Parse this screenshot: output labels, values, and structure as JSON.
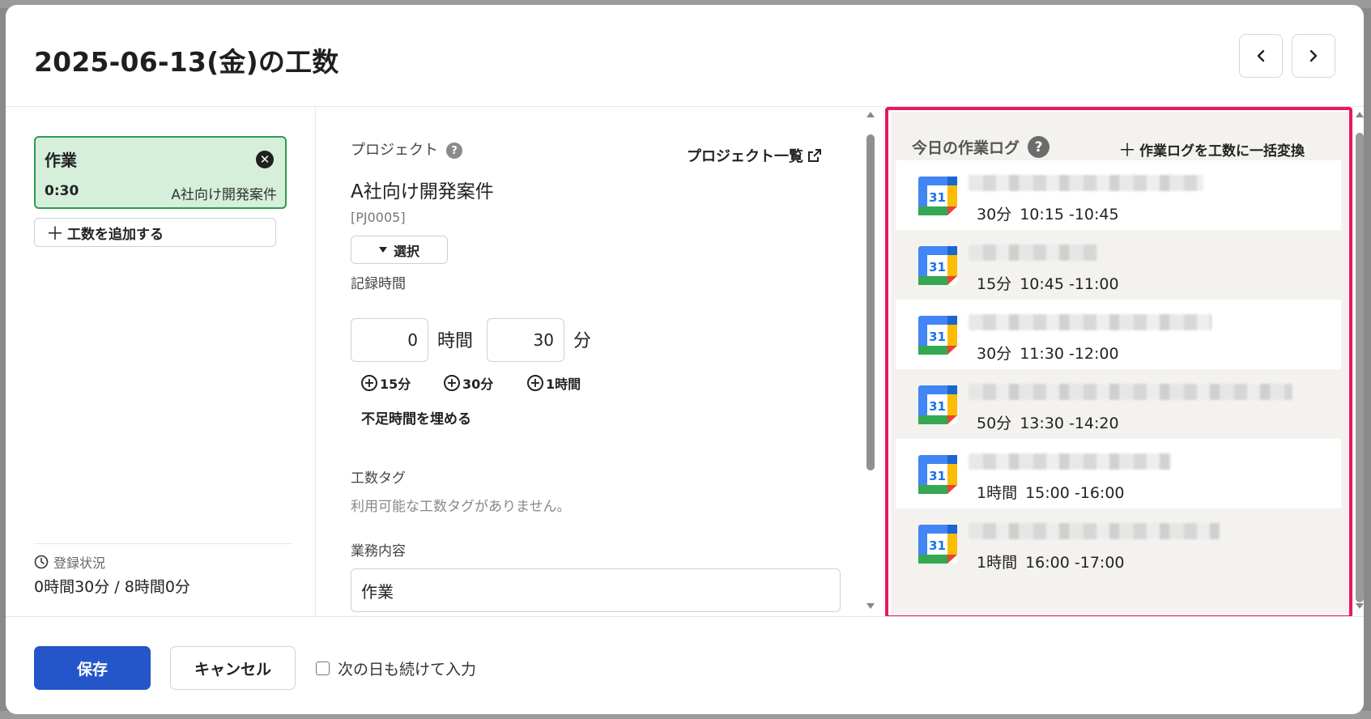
{
  "header": {
    "title": "2025-06-13(金)の工数",
    "prev_icon": "chevron-left-icon",
    "next_icon": "chevron-right-icon"
  },
  "entries": [
    {
      "title": "作業",
      "time": "0:30",
      "project": "A社向け開発案件"
    }
  ],
  "add_entry_label": "工数を追加する",
  "status": {
    "label": "登録状況",
    "value": "0時間30分 / 8時間0分"
  },
  "form": {
    "project_label": "プロジェクト",
    "project_list_link": "プロジェクト一覧",
    "project_name": "A社向け開発案件",
    "project_code": "[PJ0005]",
    "select_label": "選択",
    "record_time_label": "記録時間",
    "hours_value": "0",
    "hours_unit": "時間",
    "minutes_value": "30",
    "minutes_unit": "分",
    "quick_add": [
      "15分",
      "30分",
      "1時間"
    ],
    "fill_missing": "不足時間を埋める",
    "tag_label": "工数タグ",
    "tag_empty": "利用可能な工数タグがありません。",
    "description_label": "業務内容",
    "description_value": "作業"
  },
  "work_log": {
    "title": "今日の作業ログ",
    "bulk_convert": "作業ログを工数に一括変換",
    "calendar_icon_text": "31",
    "highlight_color": "#e8195f",
    "items": [
      {
        "duration": "30分",
        "range": "10:15 -10:45"
      },
      {
        "duration": "15分",
        "range": "10:45 -11:00"
      },
      {
        "duration": "30分",
        "range": "11:30 -12:00"
      },
      {
        "duration": "50分",
        "range": "13:30 -14:20"
      },
      {
        "duration": "1時間",
        "range": "15:00 -16:00"
      },
      {
        "duration": "1時間",
        "range": "16:00 -17:00"
      }
    ]
  },
  "footer": {
    "save_label": "保存",
    "cancel_label": "キャンセル",
    "continue_label": "次の日も続けて入力",
    "continue_checked": false
  },
  "colors": {
    "primary": "#2456c9",
    "entry_bg": "#d5efdb",
    "entry_border": "#2e9c4f"
  }
}
